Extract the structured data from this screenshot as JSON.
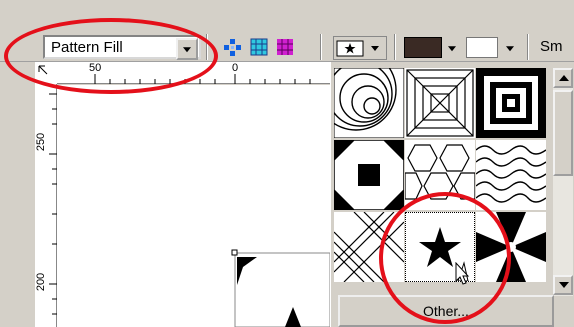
{
  "toolbar": {
    "fill_type_value": "Pattern Fill",
    "tool_icons": [
      "diamond-dots-icon",
      "grid-blue-icon",
      "grid-magenta-icon"
    ],
    "pattern_button_icon": "star-pattern-icon",
    "foreground_color": "#3a2a24",
    "background_color": "#ffffff",
    "sm_label": "Sm"
  },
  "ruler": {
    "horizontal_labels": [
      "50",
      "0"
    ],
    "vertical_labels": [
      "250",
      "200"
    ]
  },
  "pattern_panel": {
    "patterns": [
      "concentric-arcs-pattern",
      "square-tunnel-pattern",
      "concentric-squares-pattern",
      "octagon-tile-pattern",
      "hexagon-tile-pattern",
      "wavy-lines-pattern",
      "diagonal-basket-pattern",
      "star-pattern",
      "pinwheel-pattern"
    ],
    "selected": "star-pattern",
    "other_label": "Other..."
  },
  "highlight_color": "#e4101a"
}
